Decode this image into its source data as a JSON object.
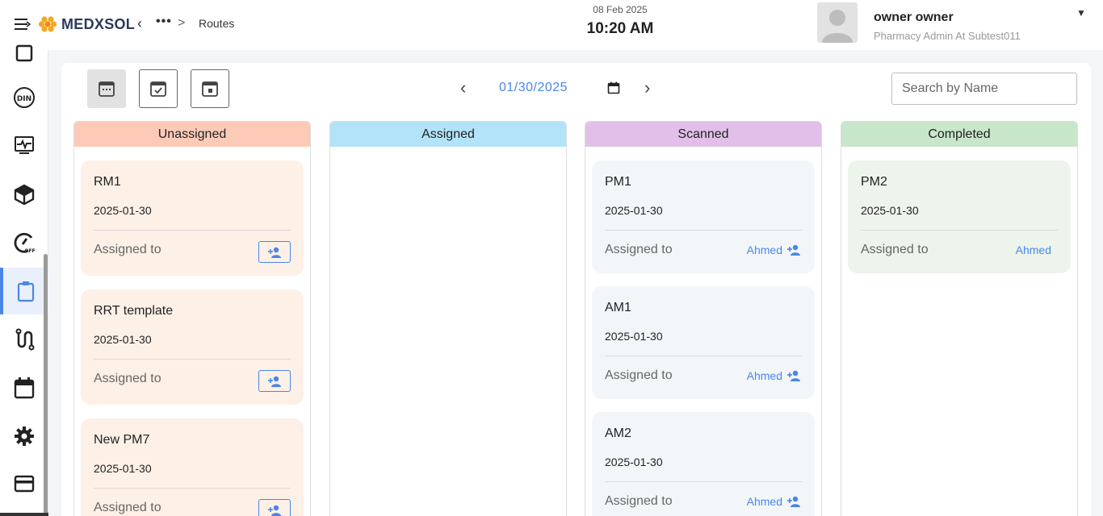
{
  "header": {
    "app_name": "MEDXSOL",
    "breadcrumb_dots": "•••",
    "breadcrumb_sep": ">",
    "page": "Routes",
    "date": "08 Feb 2025",
    "time": "10:20 AM",
    "user_name": "owner owner",
    "user_role": "Pharmacy Admin At Subtest011"
  },
  "sidebar": {
    "items": [
      "box-icon",
      "din-icon",
      "activity-icon",
      "cube-icon",
      "speed-off-icon",
      "clipboard-icon",
      "route-icon",
      "calendar-icon",
      "settings-icon",
      "card-icon"
    ],
    "active": "clipboard-icon"
  },
  "toolbar": {
    "date_value": "01/30/2025",
    "search_placeholder": "Search by Name",
    "prev": "‹",
    "next": "›"
  },
  "columns": [
    {
      "title": "Unassigned",
      "color": "#fdcab8",
      "cards": [
        {
          "name": "RM1",
          "date": "2025-01-30",
          "assigned_label": "Assigned to"
        },
        {
          "name": "RRT template",
          "date": "2025-01-30",
          "assigned_label": "Assigned to"
        },
        {
          "name": "New PM7",
          "date": "2025-01-30",
          "assigned_label": "Assigned to"
        }
      ]
    },
    {
      "title": "Assigned",
      "color": "#b3e3f9",
      "cards": []
    },
    {
      "title": "Scanned",
      "color": "#e1bfe8",
      "cards": [
        {
          "name": "PM1",
          "date": "2025-01-30",
          "assigned_label": "Assigned to",
          "assignee": "Ahmed"
        },
        {
          "name": "AM1",
          "date": "2025-01-30",
          "assigned_label": "Assigned to",
          "assignee": "Ahmed"
        },
        {
          "name": "AM2",
          "date": "2025-01-30",
          "assigned_label": "Assigned to",
          "assignee": "Ahmed"
        }
      ]
    },
    {
      "title": "Completed",
      "color": "#c8e6c9",
      "cards": [
        {
          "name": "PM2",
          "date": "2025-01-30",
          "assigned_label": "Assigned to",
          "assignee": "Ahmed"
        }
      ]
    }
  ],
  "colors": {
    "accent": "#4a86e8",
    "unassigned_card": "#fdf0e6",
    "scanned_card": "#f3f6f8",
    "completed_card": "#edf4ec"
  }
}
